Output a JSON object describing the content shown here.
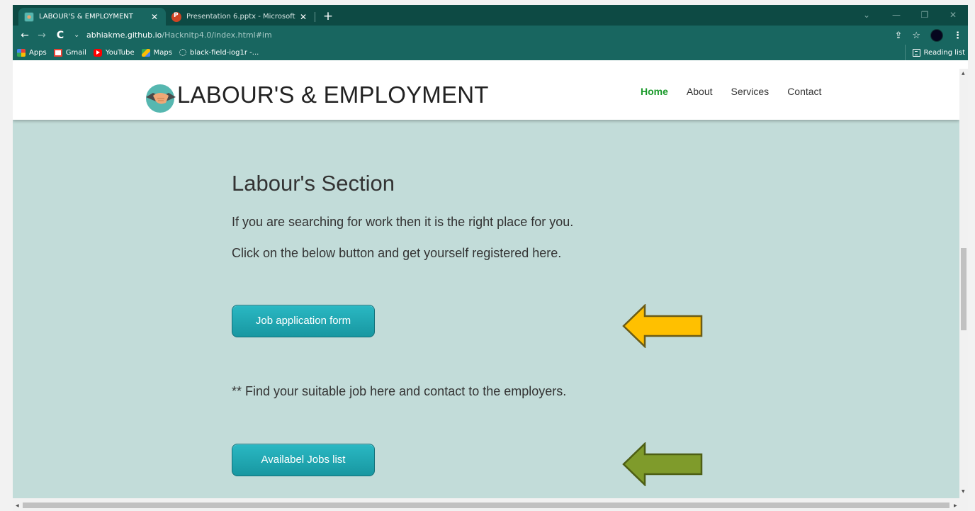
{
  "browser": {
    "tabs": [
      {
        "title": "LABOUR'S & EMPLOYMENT",
        "active": true,
        "icon": "site-favicon"
      },
      {
        "title": "Presentation 6.pptx - Microsoft P",
        "active": false,
        "icon": "powerpoint-icon"
      }
    ],
    "new_tab_glyph": "+",
    "close_glyph": "✕",
    "window_controls": {
      "minimize": "—",
      "restore": "❐",
      "close": "✕",
      "tab_search": "⌄"
    },
    "nav": {
      "back": "←",
      "forward": "→",
      "reload": "C",
      "dropdown": "⌄"
    },
    "url_host": "abhiakme.github.io",
    "url_path": "/Hacknitp4.0/index.html#im",
    "addr_icons": {
      "share": "⇪",
      "star": "☆",
      "menu": "⋮"
    },
    "bookmarks": [
      {
        "label": "Apps",
        "icon": "apps-icon"
      },
      {
        "label": "Gmail",
        "icon": "gmail-icon"
      },
      {
        "label": "YouTube",
        "icon": "youtube-icon"
      },
      {
        "label": "Maps",
        "icon": "maps-icon"
      },
      {
        "label": "black-field-iog1r -...",
        "icon": "globe-icon"
      }
    ],
    "reading_list": "Reading list"
  },
  "site": {
    "title": "LABOUR'S & EMPLOYMENT",
    "nav": [
      {
        "label": "Home",
        "active": true
      },
      {
        "label": "About",
        "active": false
      },
      {
        "label": "Services",
        "active": false
      },
      {
        "label": "Contact",
        "active": false
      }
    ]
  },
  "section": {
    "title": "Labour's Section",
    "line1": "If you are searching for work then it is the right place for you.",
    "line2": "Click on the below button and get yourself registered here.",
    "button1": "Job application form",
    "line3": "** Find your suitable job here and contact to the employers.",
    "button2": "Availabel Jobs list"
  },
  "colors": {
    "browser_dark": "#0d4a44",
    "browser_light": "#186660",
    "page_bg": "#c2dcd9",
    "nav_active": "#1a9a2a",
    "button": "#1ea9b3",
    "arrow1_fill": "#ffc000",
    "arrow2_fill": "#7f9b2b"
  }
}
